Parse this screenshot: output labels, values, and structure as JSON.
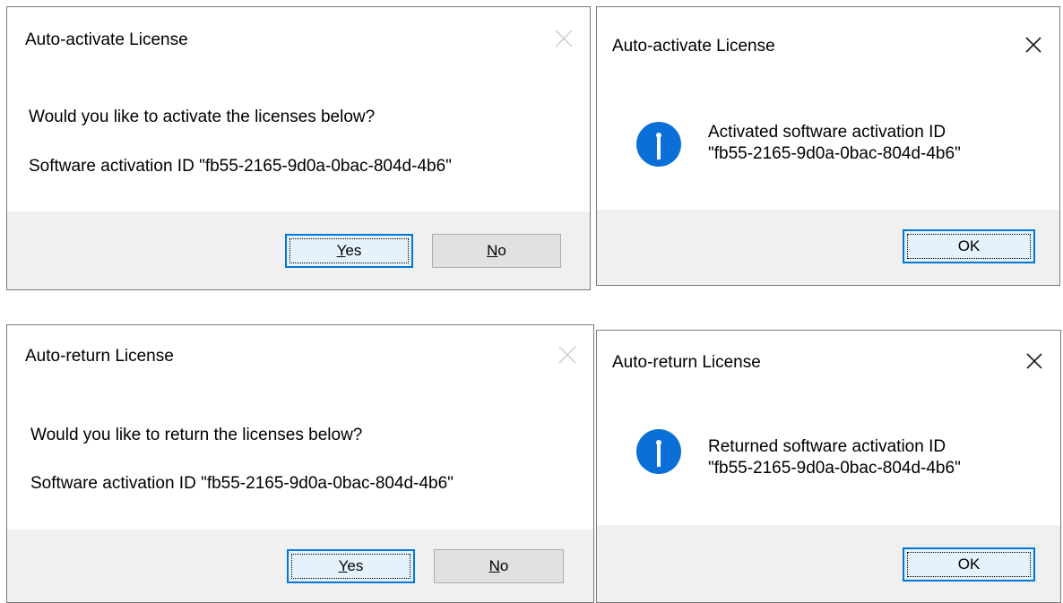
{
  "dialogs": {
    "activate_confirm": {
      "title": "Auto-activate License",
      "question": "Would you like to activate the licenses below?",
      "detail": "Software activation ID \"fb55-2165-9d0a-0bac-804d-4b6\"",
      "yes_mnemonic": "Y",
      "yes_rest": "es",
      "no_mnemonic": "N",
      "no_rest": "o"
    },
    "activate_result": {
      "title": "Auto-activate License",
      "line1": "Activated software activation ID",
      "line2": "\"fb55-2165-9d0a-0bac-804d-4b6\"",
      "ok_label": "OK",
      "icon": "info-icon"
    },
    "return_confirm": {
      "title": "Auto-return License",
      "question": "Would you like to return the licenses below?",
      "detail": "Software activation ID \"fb55-2165-9d0a-0bac-804d-4b6\"",
      "yes_mnemonic": "Y",
      "yes_rest": "es",
      "no_mnemonic": "N",
      "no_rest": "o"
    },
    "return_result": {
      "title": "Auto-return License",
      "line1": "Returned software activation ID",
      "line2": "\"fb55-2165-9d0a-0bac-804d-4b6\"",
      "ok_label": "OK",
      "icon": "info-icon"
    }
  },
  "colors": {
    "accent": "#0078d7",
    "footer_bg": "#f0f0f0",
    "info_icon": "#0a6fd6"
  }
}
